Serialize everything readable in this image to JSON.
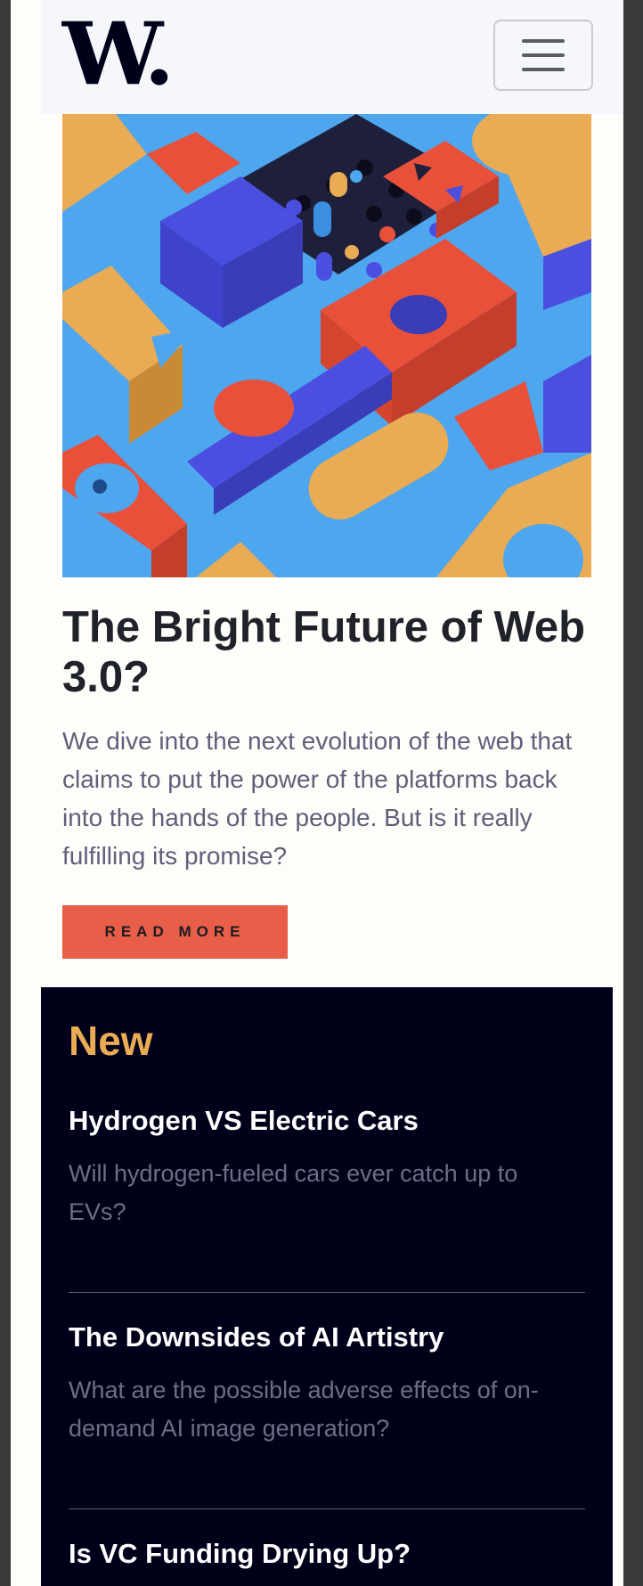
{
  "header": {
    "logo_text": "W.",
    "menu_icon": "hamburger-menu-icon"
  },
  "hero": {
    "image_icon": "abstract-geometric-blocks-image",
    "title": "The Bright Future of Web 3.0?",
    "description": "We dive into the next evolution of the web that claims to put the power of the platforms back into the hands of the people. But is it really fulfilling its promise?",
    "button_label": "READ MORE"
  },
  "new_section": {
    "heading": "New",
    "items": [
      {
        "title": "Hydrogen VS Electric Cars",
        "description": "Will hydrogen-fueled cars ever catch up to EVs?"
      },
      {
        "title": "The Downsides of AI Artistry",
        "description": "What are the possible adverse effects of on-demand AI image generation?"
      },
      {
        "title": "Is VC Funding Drying Up?",
        "description": ""
      }
    ]
  },
  "colors": {
    "accent_red": "#e85e48",
    "accent_orange": "#e9ab53",
    "dark_navy": "#00001a",
    "page_bg": "#fffdfa",
    "text_dark": "#1f2329",
    "text_muted": "#5e607a"
  }
}
